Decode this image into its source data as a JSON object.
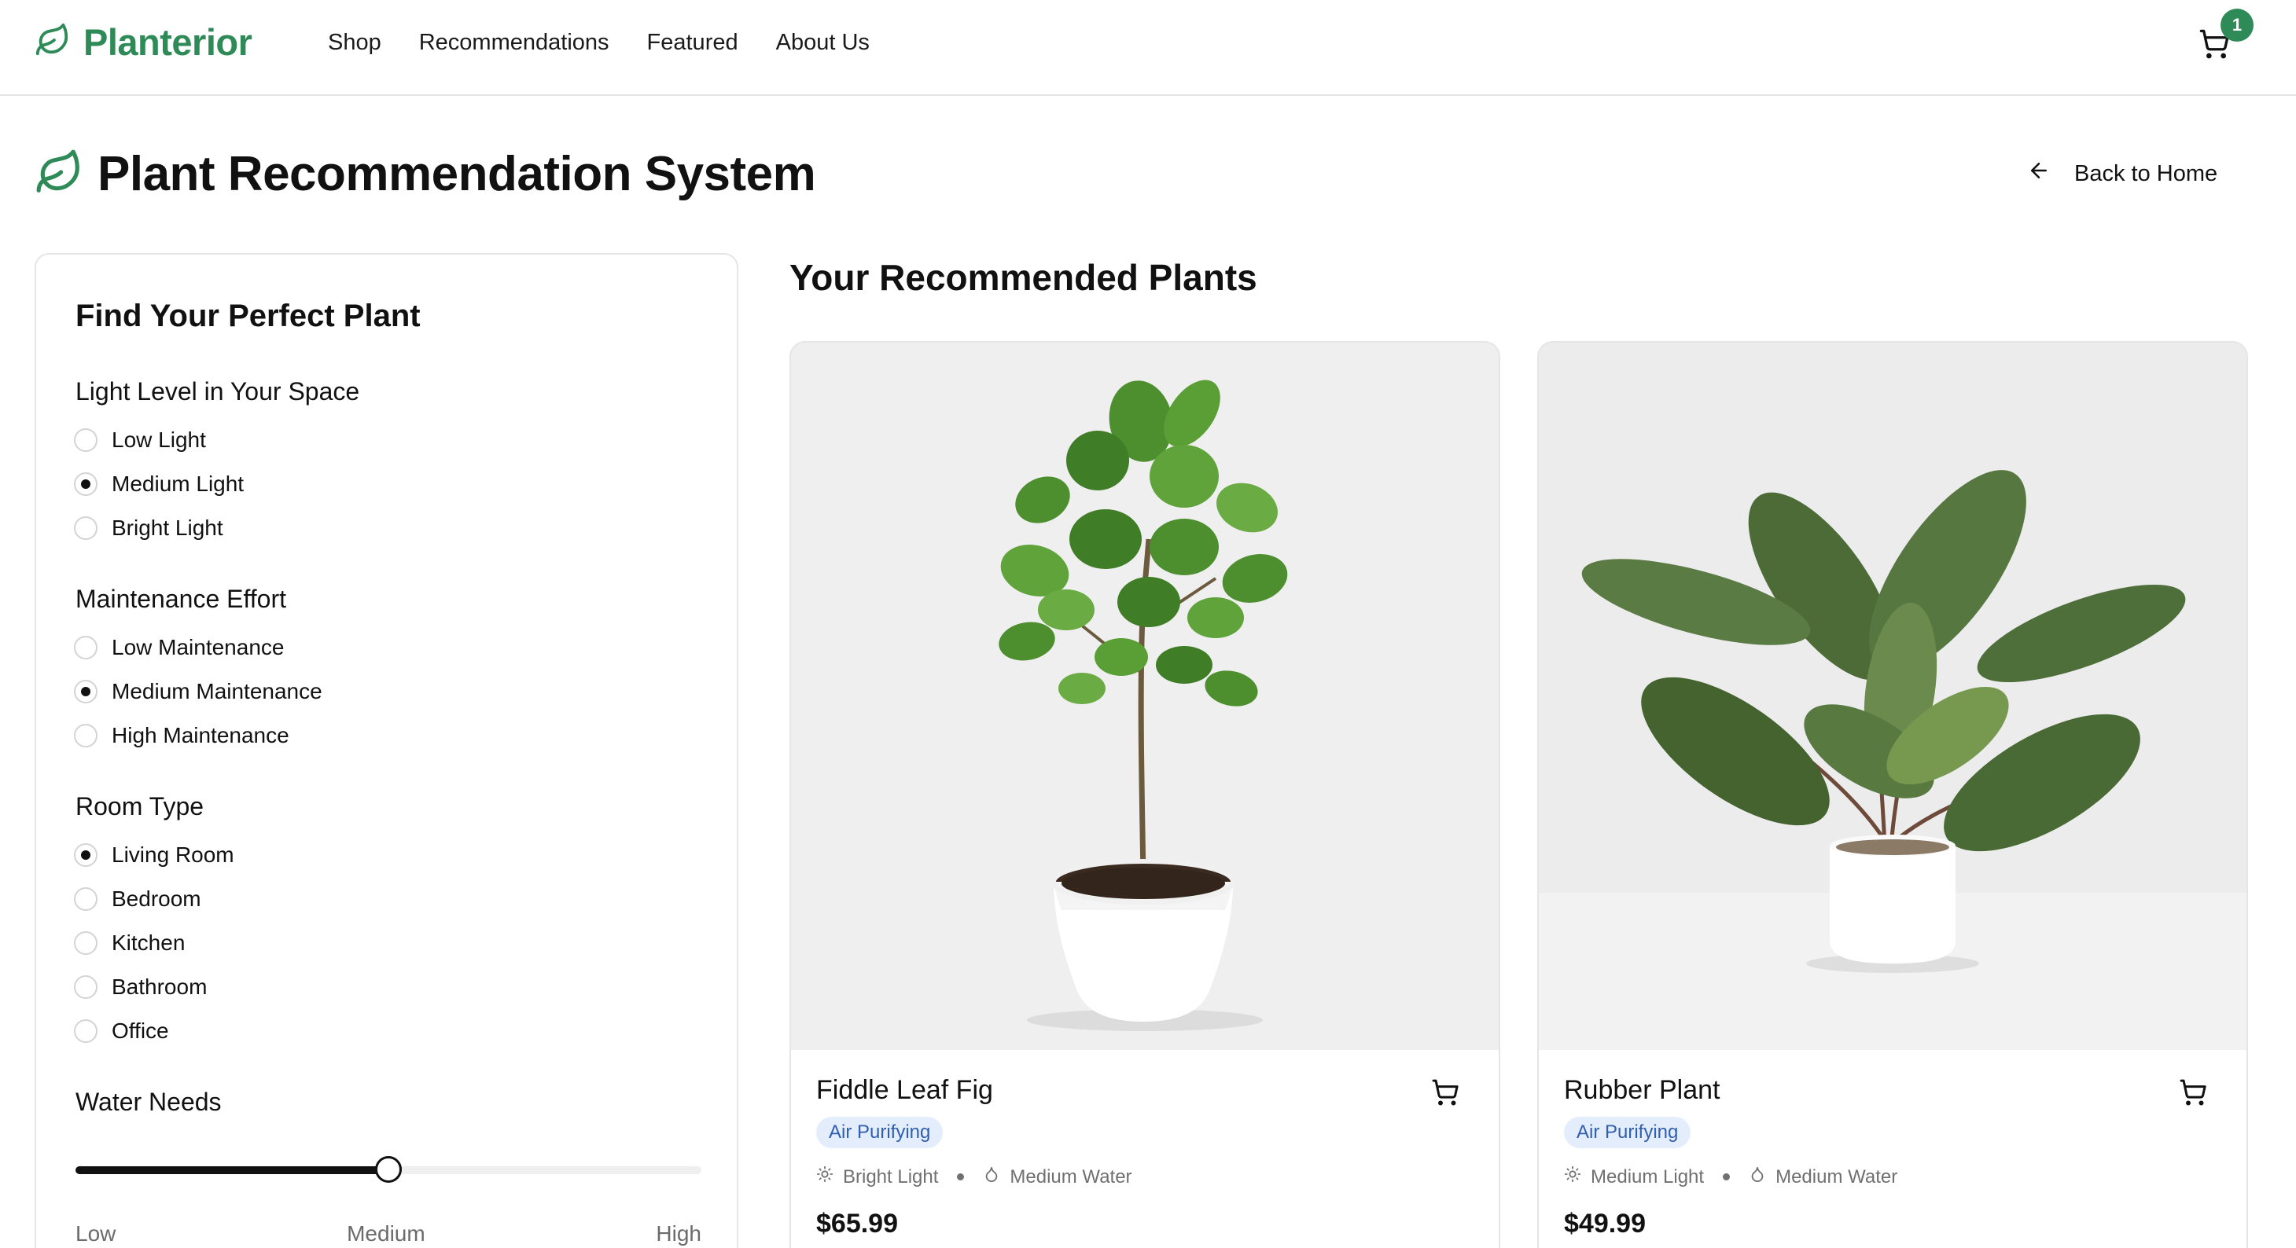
{
  "header": {
    "brand": "Planterior",
    "nav": [
      "Shop",
      "Recommendations",
      "Featured",
      "About Us"
    ],
    "cart_count": "1"
  },
  "page": {
    "title": "Plant Recommendation System",
    "back_label": "Back to Home"
  },
  "filters": {
    "title": "Find Your Perfect Plant",
    "light": {
      "label": "Light Level in Your Space",
      "options": [
        "Low Light",
        "Medium Light",
        "Bright Light"
      ],
      "selected": "Medium Light"
    },
    "maintenance": {
      "label": "Maintenance Effort",
      "options": [
        "Low Maintenance",
        "Medium Maintenance",
        "High Maintenance"
      ],
      "selected": "Medium Maintenance"
    },
    "room": {
      "label": "Room Type",
      "options": [
        "Living Room",
        "Bedroom",
        "Kitchen",
        "Bathroom",
        "Office"
      ],
      "selected": "Living Room"
    },
    "water": {
      "label": "Water Needs",
      "value_fraction": 0.5,
      "labels": [
        "Low",
        "Medium",
        "High"
      ]
    }
  },
  "recommendations": {
    "title": "Your Recommended Plants",
    "cards": [
      {
        "name": "Fiddle Leaf Fig",
        "tag": "Air Purifying",
        "light": "Bright Light",
        "water": "Medium Water",
        "price": "$65.99"
      },
      {
        "name": "Rubber Plant",
        "tag": "Air Purifying",
        "light": "Medium Light",
        "water": "Medium Water",
        "price": "$49.99"
      }
    ]
  },
  "colors": {
    "brand": "#2e8b57",
    "tag_bg": "#e4edfb",
    "tag_text": "#2f5fae"
  }
}
